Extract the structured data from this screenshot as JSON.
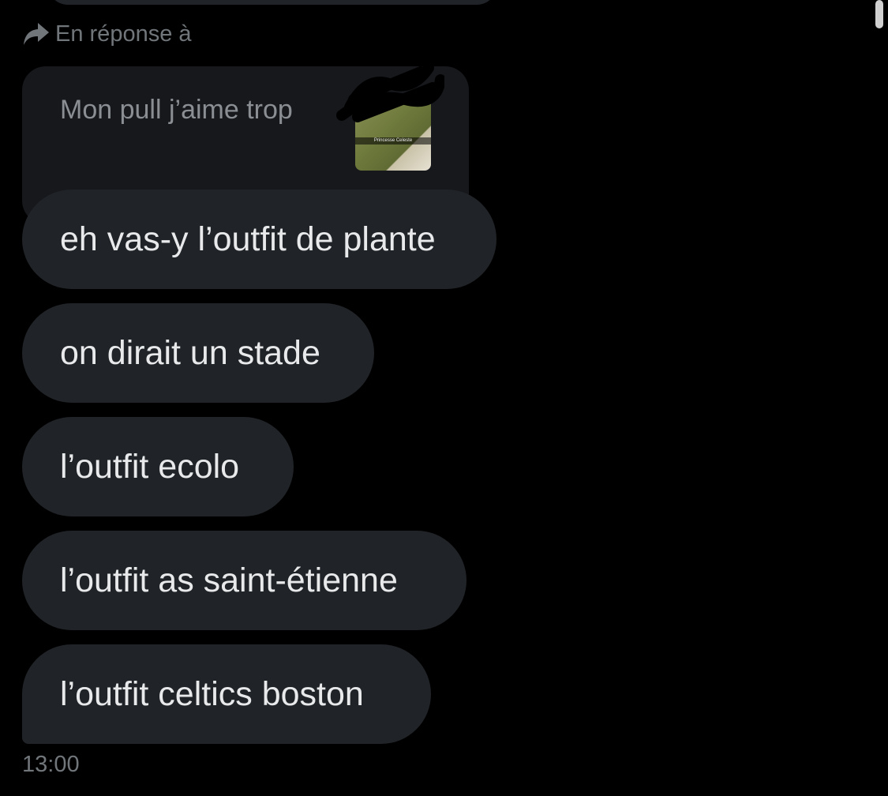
{
  "reply_context": {
    "label": "En réponse à",
    "quoted_text": "Mon pull j’aime trop",
    "thumbnail_caption": "Princesse Celeste",
    "icon": "reply-arrow-icon"
  },
  "messages": [
    {
      "text": "eh vas-y l’outfit de plante"
    },
    {
      "text": "on dirait un stade"
    },
    {
      "text": "l’outfit ecolo"
    },
    {
      "text": "l’outfit as saint-étienne"
    },
    {
      "text": "l’outfit celtics boston"
    }
  ],
  "timestamp": "13:00",
  "colors": {
    "background": "#000000",
    "bubble": "#202327",
    "quoted_bubble": "#16181c",
    "text": "#e7e9ea",
    "muted_text": "#71767b"
  }
}
